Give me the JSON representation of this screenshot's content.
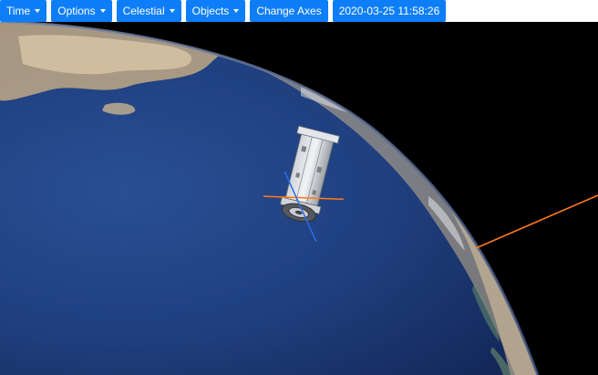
{
  "toolbar": {
    "menus": [
      {
        "label": "Time",
        "has_dropdown": true
      },
      {
        "label": "Options",
        "has_dropdown": true
      },
      {
        "label": "Celestial",
        "has_dropdown": true
      },
      {
        "label": "Objects",
        "has_dropdown": true
      }
    ],
    "change_axes_label": "Change Axes",
    "datetime_label": "2020-03-25 11:58:26"
  },
  "colors": {
    "button_bg": "#0d7ef7",
    "ocean": "#1c3c78",
    "space": "#000000",
    "axis_orange": "#ff7a1a",
    "axis_blue": "#2a6cf0"
  }
}
